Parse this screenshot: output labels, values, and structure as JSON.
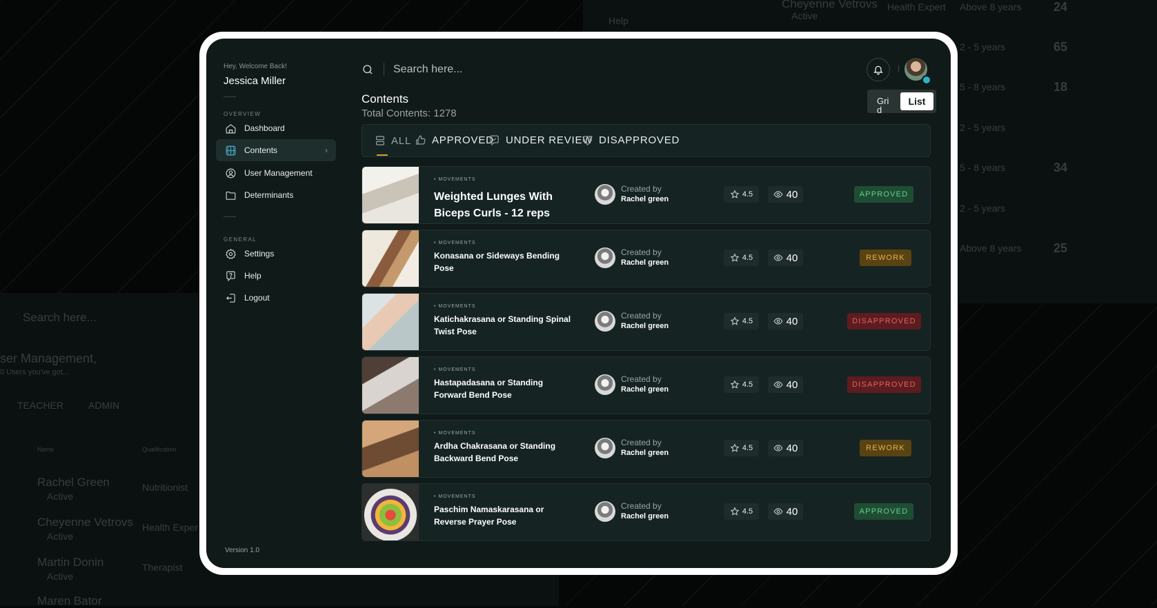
{
  "background": {
    "left_panel": {
      "search_placeholder": "Search here...",
      "title": "ser Management,",
      "subtitle": "0 Users you've got...",
      "tabs": [
        "TEACHER",
        "ADMIN"
      ],
      "columns": [
        "Name",
        "Qualification"
      ],
      "users": [
        {
          "name": "Rachel Green",
          "status": "Active",
          "qualification": "Nutritionist"
        },
        {
          "name": "Cheyenne Vetrovs",
          "status": "Active",
          "qualification": "Health Exper"
        },
        {
          "name": "Martin Donin",
          "status": "Active",
          "qualification": "Therapist"
        },
        {
          "name": "Maren Bator",
          "status": "",
          "qualification": ""
        }
      ]
    },
    "right_panel": {
      "help": "Help",
      "top_user": {
        "name": "Cheyenne Vetrovs",
        "status": "Active",
        "qualification": "Health Expert",
        "experience": "Above 8 years",
        "count": "24"
      },
      "rows": [
        {
          "experience": "2 - 5 years",
          "count": "65"
        },
        {
          "experience": "5 - 8 years",
          "count": "18"
        },
        {
          "experience": "2 - 5 years",
          "count": ""
        },
        {
          "experience": "5 - 8 years",
          "count": "34"
        },
        {
          "experience": "2 - 5 years",
          "count": ""
        },
        {
          "experience": "Above 8 years",
          "count": "25"
        }
      ]
    }
  },
  "sidebar": {
    "welcome": "Hey, Welcome Back!",
    "user_name": "Jessica Miller",
    "overview_label": "OVERVIEW",
    "general_label": "GENERAL",
    "overview_items": [
      {
        "label": "Dashboard",
        "icon": "home-icon"
      },
      {
        "label": "Contents",
        "icon": "globe-icon",
        "active": true
      },
      {
        "label": "User Management",
        "icon": "user-icon"
      },
      {
        "label": "Determinants",
        "icon": "folder-icon"
      }
    ],
    "general_items": [
      {
        "label": "Settings",
        "icon": "gear-icon"
      },
      {
        "label": "Help",
        "icon": "help-icon"
      },
      {
        "label": "Logout",
        "icon": "logout-icon"
      }
    ],
    "version": "Version 1.0"
  },
  "search": {
    "placeholder": "Search here..."
  },
  "page": {
    "title": "Contents",
    "subtitle": "Total Contents: 1278",
    "view_toggle": {
      "grid": "Grid",
      "list": "List",
      "selected": "List"
    }
  },
  "tabs": [
    {
      "label": "ALL",
      "icon": "list-icon",
      "active": true
    },
    {
      "label": "APPROVED",
      "icon": "thumbs-up-icon"
    },
    {
      "label": "UNDER REVIEW",
      "icon": "review-icon"
    },
    {
      "label": "DISAPPROVED",
      "icon": "thumbs-down-icon"
    }
  ],
  "contents": [
    {
      "category": "• MOVEMENTS",
      "title": "Weighted Lunges With Biceps Curls - 12 reps",
      "created_by_label": "Created by",
      "creator": "Rachel green",
      "rating": "4.5",
      "views": "40",
      "status": "APPROVED"
    },
    {
      "category": "• MOVEMENTS",
      "title": "Konasana or Sideways Bending Pose",
      "created_by_label": "Created by",
      "creator": "Rachel green",
      "rating": "4.5",
      "views": "40",
      "status": "REWORK"
    },
    {
      "category": "• MOVEMENTS",
      "title": "Katichakrasana or Standing Spinal Twist Pose",
      "created_by_label": "Created by",
      "creator": "Rachel green",
      "rating": "4.5",
      "views": "40",
      "status": "DISAPPROVED"
    },
    {
      "category": "• MOVEMENTS",
      "title": "Hastapadasana or Standing Forward Bend Pose",
      "created_by_label": "Created by",
      "creator": "Rachel green",
      "rating": "4.5",
      "views": "40",
      "status": "DISAPPROVED"
    },
    {
      "category": "• MOVEMENTS",
      "title": "Ardha Chakrasana or Standing Backward Bend Pose",
      "created_by_label": "Created by",
      "creator": "Rachel green",
      "rating": "4.5",
      "views": "40",
      "status": "REWORK"
    },
    {
      "category": "• MOVEMENTS",
      "title": "Paschim Namaskarasana or Reverse Prayer Pose",
      "created_by_label": "Created by",
      "creator": "Rachel green",
      "rating": "4.5",
      "views": "40",
      "status": "APPROVED"
    }
  ],
  "colors": {
    "background": "#050707",
    "panel": "#0f1a19",
    "row": "#152423",
    "approved": "#63d08f",
    "rework": "#e7b24a",
    "disapproved": "#ea5f63",
    "accent": "#4aa6c4"
  }
}
